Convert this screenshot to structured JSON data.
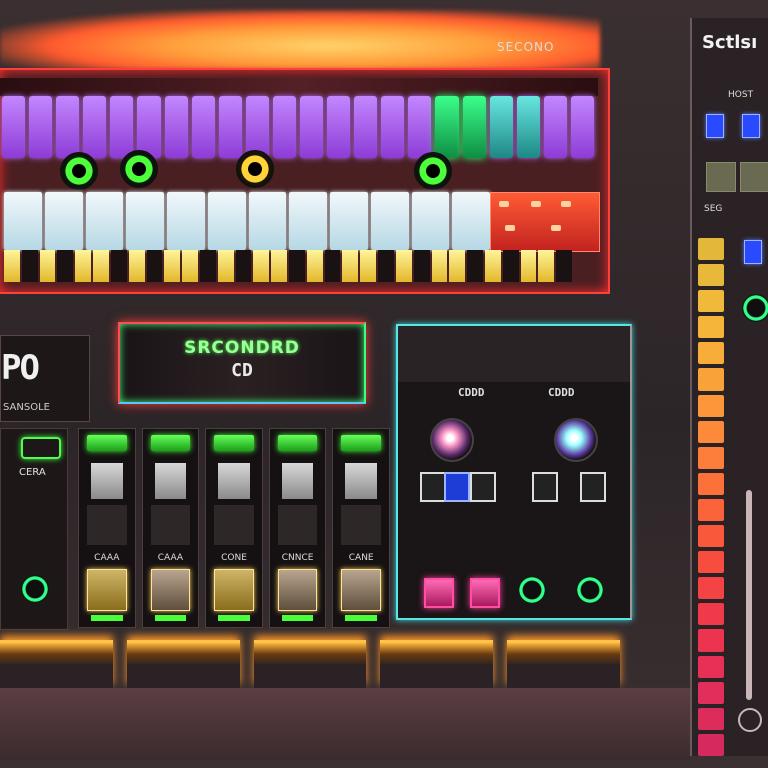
{
  "header": {
    "top_label": "SECONO"
  },
  "center_display": {
    "line1": "SRCONDRD",
    "line2": "CD"
  },
  "left_display": {
    "big": "PO",
    "sub": "SANSOLE",
    "led_label": "CERA"
  },
  "channels": [
    {
      "label": "CAAA"
    },
    {
      "label": "CAAA"
    },
    {
      "label": "CONE"
    },
    {
      "label": "CNNCE"
    },
    {
      "label": "CANE"
    }
  ],
  "right_panel": {
    "label_left": "CDDD",
    "label_right": "CDDD"
  },
  "sidebar": {
    "title": "Sctlsı",
    "text1": "HOST",
    "text2": "SEG"
  },
  "colors": {
    "accent_red": "#ff3f3a",
    "accent_green": "#4dff4d",
    "accent_cyan": "#58e6e6",
    "pad_purple": "#b66bff",
    "meter_yellow": "#ffcf3a",
    "meter_red": "#ff3a3a"
  }
}
